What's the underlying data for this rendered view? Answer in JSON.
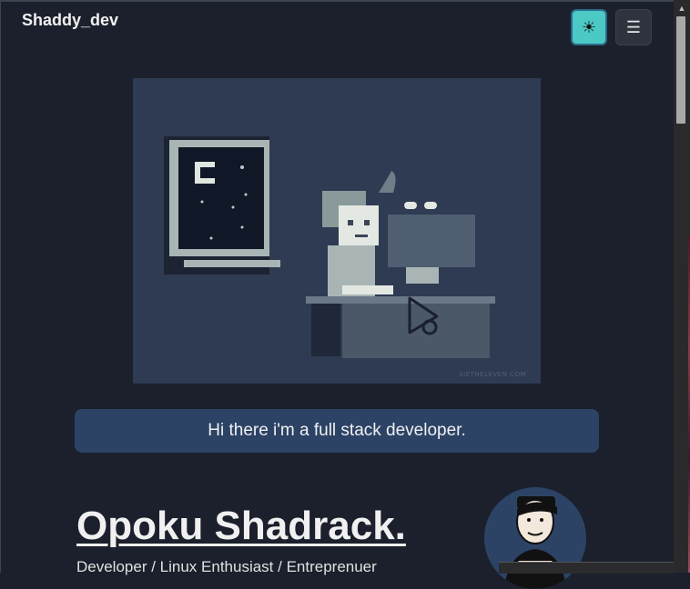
{
  "navbar": {
    "brand": "Shaddy_dev",
    "theme_toggle_icon": "gear-icon",
    "menu_icon": "hamburger-icon",
    "theme_toggle_glyph": "☀",
    "menu_glyph": "☰"
  },
  "hero": {
    "image": "pixel-art-coder-at-desk",
    "watermark": "SIETHELEVEN.COM",
    "play_icon": "play-icon"
  },
  "banner": {
    "text": "Hi there i'm a full stack developer."
  },
  "intro": {
    "name": "Opoku Shadrack.",
    "subtitle": "Developer / Linux Enthusiast / Entreprenuer"
  },
  "colors": {
    "background": "#1b202c",
    "accent_teal": "#4cc9c4",
    "banner_bg": "#2c4366"
  }
}
